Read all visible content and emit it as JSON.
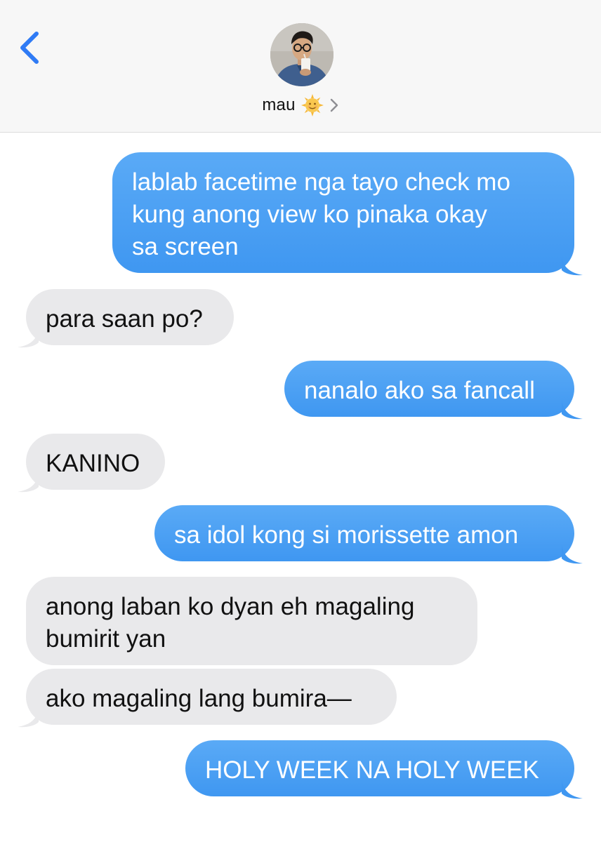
{
  "header": {
    "contact_name": "mau",
    "contact_emoji": "sun-with-face",
    "back_icon": "chevron-left-icon",
    "detail_icon": "chevron-right-icon"
  },
  "colors": {
    "sent_bubble": "#4ba3f5",
    "received_bubble": "#e9e9eb",
    "back_chevron": "#2f7bf5",
    "header_bg": "#f7f7f7"
  },
  "messages": [
    {
      "direction": "sent",
      "lines": [
        "lablab facetime nga tayo check mo",
        "kung anong view ko pinaka okay",
        "sa screen"
      ]
    },
    {
      "direction": "received",
      "lines": [
        "para saan po?"
      ]
    },
    {
      "direction": "sent",
      "lines": [
        "nanalo ako sa fancall"
      ]
    },
    {
      "direction": "received",
      "lines": [
        "KANINO"
      ]
    },
    {
      "direction": "sent",
      "lines": [
        "sa idol kong si morissette amon"
      ]
    },
    {
      "direction": "received",
      "lines": [
        "anong laban ko dyan eh magaling",
        "bumirit yan"
      ]
    },
    {
      "direction": "received",
      "lines": [
        "ako magaling lang bumira—"
      ]
    },
    {
      "direction": "sent",
      "lines": [
        "HOLY WEEK NA HOLY WEEK"
      ]
    }
  ]
}
